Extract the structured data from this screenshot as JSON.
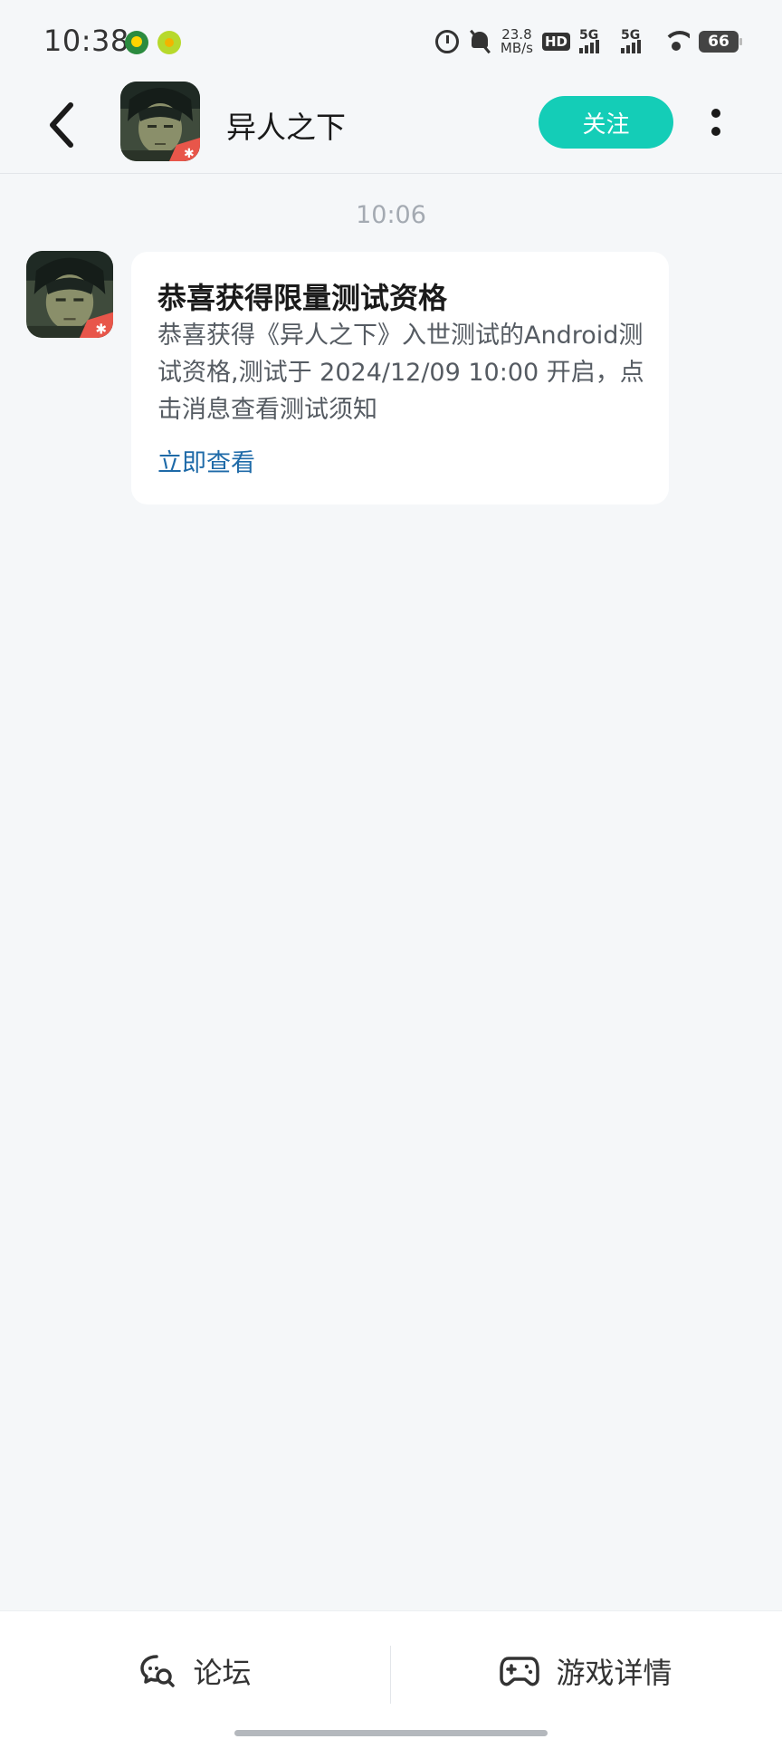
{
  "status_bar": {
    "time": "10:38",
    "speed_value": "23.8",
    "speed_unit": "MB/s",
    "hd_label": "HD",
    "network_1": "5G",
    "network_2": "5G",
    "battery": "66"
  },
  "header": {
    "title": "异人之下",
    "follow_label": "关注"
  },
  "chat": {
    "timestamp": "10:06",
    "message": {
      "title": "恭喜获得限量测试资格",
      "body": "恭喜获得《异人之下》入世测试的Android测试资格,测试于 2024/12/09 10:00 开启，点击消息查看测试须知",
      "link_label": "立即查看"
    }
  },
  "bottom_bar": {
    "forum_label": "论坛",
    "details_label": "游戏详情"
  },
  "colors": {
    "accent": "#14cdb7",
    "link": "#1e6aa8",
    "background": "#f5f7f9"
  }
}
